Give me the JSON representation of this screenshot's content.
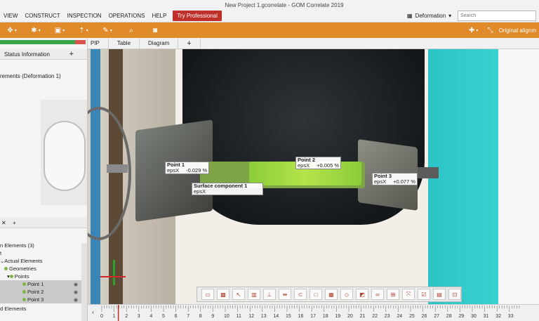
{
  "window": {
    "title": "New Project 1.gcorrelate - GOM Correlate 2019"
  },
  "menu": {
    "items": [
      "VIEW",
      "CONSTRUCT",
      "INSPECTION",
      "OPERATIONS",
      "HELP"
    ],
    "try_pro": "Try Professional"
  },
  "header": {
    "deformation_label": "Deformation",
    "search_placeholder": "Search"
  },
  "toolbar": {
    "alignment_label": "Original alignm"
  },
  "left_panel": {
    "status_tab": "Status Information",
    "elements_header": "rements (Deformation 1)",
    "tree": {
      "root": "n Elements (3)",
      "rows": [
        "t",
        "Actual Elements",
        "Geometries",
        "Points",
        "Point 1",
        "Point 2",
        "Point 3"
      ],
      "footer": "d Elements"
    }
  },
  "view_tabs": [
    "PIP",
    "Table",
    "Diagram"
  ],
  "labels": {
    "point1": {
      "name": "Point 1",
      "key": "epsX",
      "value": "-0.029 %"
    },
    "point2": {
      "name": "Point 2",
      "key": "epsX",
      "value": "+0.005 %"
    },
    "point3": {
      "name": "Point 3",
      "key": "epsX",
      "value": "+0.077 %"
    },
    "surface": {
      "name": "Surface component 1",
      "key": "epsX"
    }
  },
  "timeline": {
    "ticks": [
      "0",
      "1",
      "2",
      "3",
      "4",
      "5",
      "6",
      "7",
      "8",
      "9",
      "10",
      "11",
      "12",
      "13",
      "14",
      "15",
      "16",
      "17",
      "18",
      "19",
      "20",
      "21",
      "22",
      "23",
      "24",
      "25",
      "26",
      "27",
      "28",
      "29",
      "30",
      "31",
      "32",
      "33"
    ]
  },
  "colors": {
    "accent": "#e08a2a",
    "try_pro": "#c0302a",
    "strain_green": "#8ccc3a"
  }
}
